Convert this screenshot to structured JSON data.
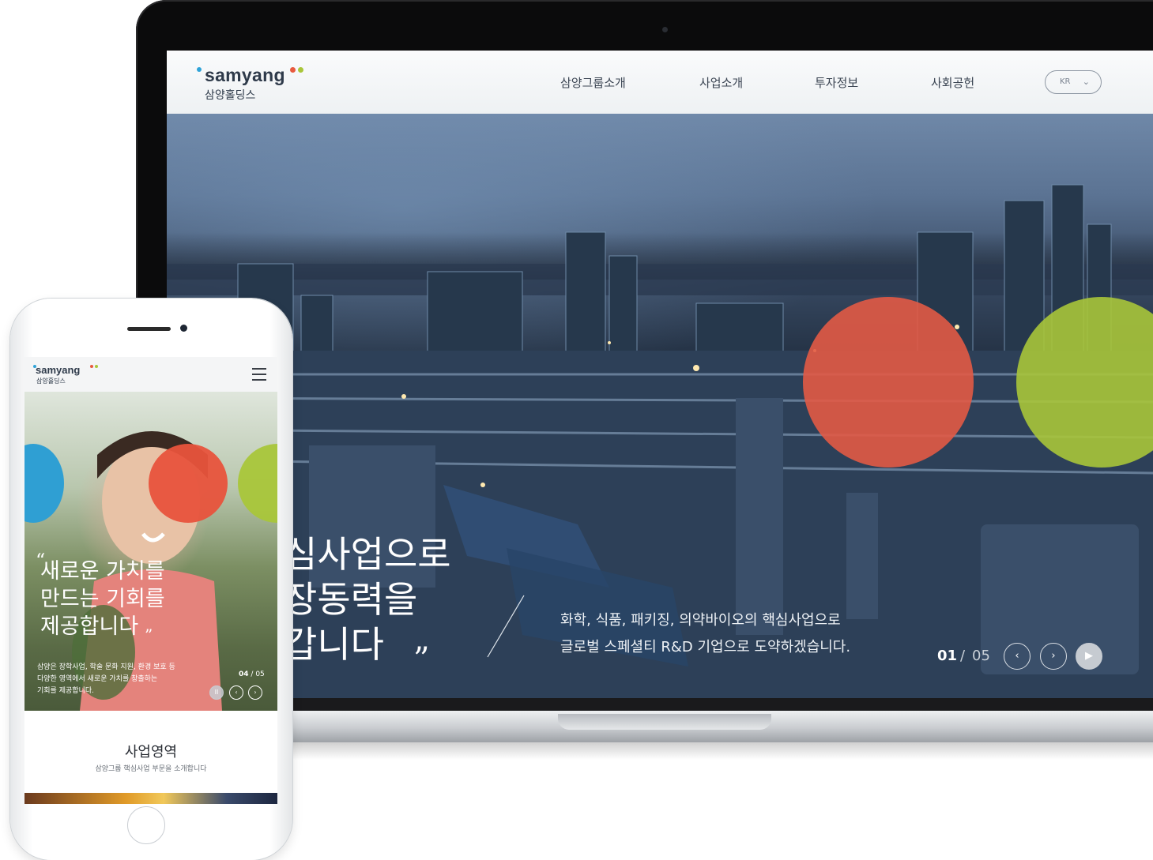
{
  "brand": {
    "wordmark": "samyang",
    "subtitle": "삼양홀딩스",
    "colors": {
      "blue": "#2fa3d8",
      "red": "#e85a3f",
      "green": "#a9c63a"
    }
  },
  "desktop": {
    "nav": [
      "삼양그룹소개",
      "사업소개",
      "투자정보",
      "사회공헌"
    ],
    "lang": {
      "label": "KR",
      "icon": "chevron-down-icon"
    },
    "hero": {
      "title": "핵심사업으로\n성장동력을\n키워갑니다",
      "title_visible": "심사업으로\n장동력을\n갑니다",
      "quote_close": "”",
      "subtitle": "화학, 식품, 패키징, 의약바이오의 핵심사업으로\n글로벌 스페셜티 R&D 기업으로 도약하겠습니다.",
      "slide_current": "01",
      "slide_separator": "/",
      "slide_total": "05",
      "controls": {
        "prev": "‹",
        "next": "›",
        "play": "▶"
      }
    }
  },
  "mobile": {
    "menu_icon": "hamburger-icon",
    "hero": {
      "quote_open": "“",
      "title": "새로운 가치를\n만드는 기회를\n제공합니다",
      "quote_close": "”",
      "subtitle": "삼양은 장학사업, 학술 문화 지원, 환경 보호 등\n다양한 영역에서 새로운 가치를 창출하는\n기회를 제공합니다.",
      "slide_current": "04",
      "slide_separator": "/",
      "slide_total": "05",
      "controls": {
        "pause": "II",
        "prev": "‹",
        "next": "›"
      }
    },
    "section": {
      "title": "사업영역",
      "subtitle": "삼양그룹 핵심사업 부문을 소개합니다"
    }
  }
}
